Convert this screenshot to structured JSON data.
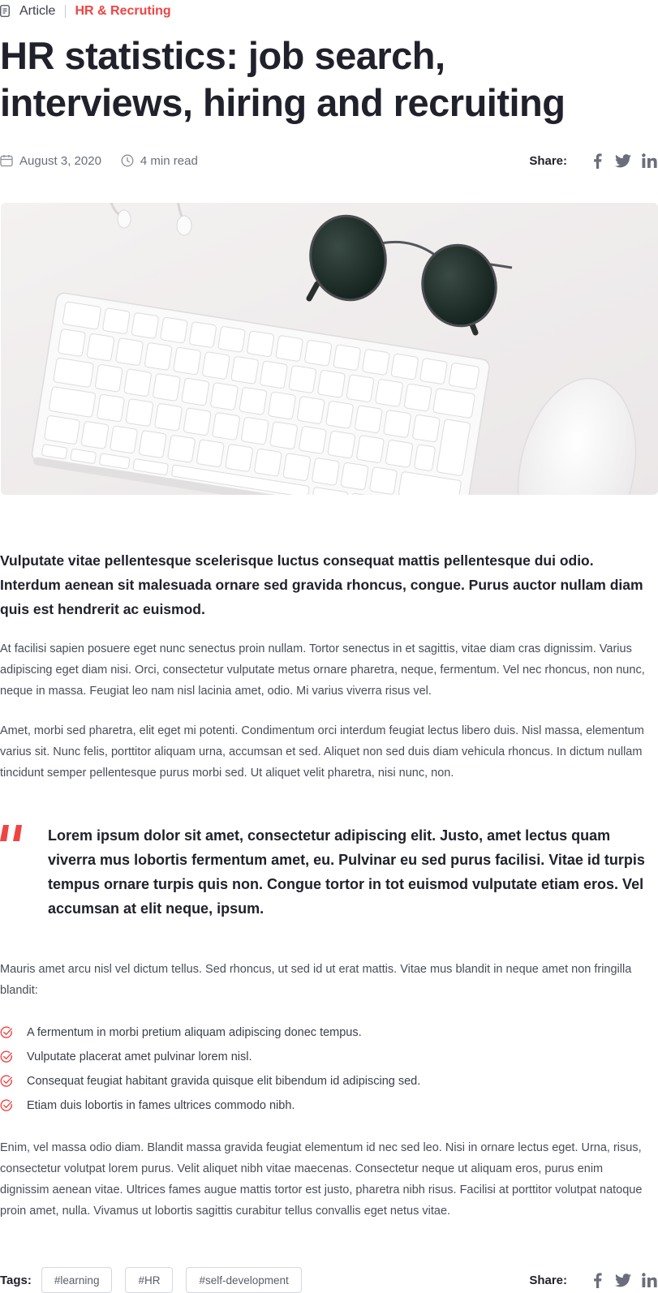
{
  "breadcrumb": {
    "type_label": "Article",
    "category_label": "HR & Recruting"
  },
  "article": {
    "title": "HR statistics: job search,  interviews, hiring and recruiting",
    "date": "August 3, 2020",
    "read_time": "4 min read",
    "share_label": "Share:",
    "hero_image": "keyboard-sunglasses-mouse-photo",
    "lead": "Vulputate vitae pellentesque scelerisque luctus consequat mattis pellentesque dui odio. Interdum aenean sit malesuada ornare sed gravida rhoncus, congue. Purus auctor nullam diam quis est hendrerit ac euismod.",
    "paragraph_1": "At facilisi sapien posuere eget nunc senectus proin nullam. Tortor senectus in et sagittis, vitae diam cras dignissim. Varius adipiscing eget diam nisi. Orci, consectetur vulputate metus ornare pharetra, neque, fermentum. Vel nec rhoncus, non nunc, neque in massa. Feugiat leo nam nisl lacinia amet, odio. Mi varius viverra risus vel.",
    "paragraph_2": "Amet, morbi sed pharetra, elit eget mi potenti. Condimentum orci interdum feugiat lectus libero duis. Nisl massa, elementum varius sit. Nunc felis, porttitor aliquam urna, accumsan et sed. Aliquet non sed duis diam vehicula rhoncus. In dictum nullam tincidunt semper pellentesque purus morbi sed. Ut aliquet velit pharetra, nisi nunc, non.",
    "quote": "Lorem ipsum dolor sit amet, consectetur adipiscing elit. Justo, amet lectus quam viverra mus lobortis fermentum amet, eu. Pulvinar eu sed purus  facilisi. Vitae id turpis tempus ornare turpis quis non. Congue tortor in tot euismod vulputate etiam eros. Vel accumsan at elit neque, ipsum.",
    "paragraph_3": "Mauris amet arcu nisl vel dictum tellus. Sed rhoncus, ut sed id ut erat mattis. Vitae mus blandit in neque amet non fringilla blandit:",
    "checklist": [
      "A fermentum in morbi pretium aliquam adipiscing donec tempus.",
      "Vulputate placerat amet pulvinar lorem nisl.",
      "Consequat feugiat habitant gravida quisque elit bibendum id adipiscing sed.",
      "Etiam duis lobortis in fames ultrices commodo nibh."
    ],
    "paragraph_4": "Enim, vel massa odio diam. Blandit massa gravida feugiat elementum id nec sed leo. Nisi in ornare lectus eget. Urna, risus, consectetur volutpat lorem purus. Velit aliquet nibh vitae maecenas. Consectetur neque ut aliquam eros, purus enim dignissim aenean vitae. Ultrices fames augue mattis tortor est justo, pharetra nibh risus. Facilisi at porttitor volutpat natoque proin amet, nulla. Vivamus ut lobortis sagittis curabitur tellus convallis eget netus vitae."
  },
  "footer": {
    "tags_label": "Tags:",
    "tags": [
      "#learning",
      "#HR",
      "#self-development"
    ],
    "share_label": "Share:"
  },
  "icons": {
    "document": "document-icon",
    "calendar": "calendar-icon",
    "clock": "clock-icon",
    "facebook": "facebook-icon",
    "twitter": "twitter-icon",
    "linkedin": "linkedin-icon",
    "quote": "quote-icon",
    "check": "check-circle-icon"
  },
  "colors": {
    "accent": "#ef4444",
    "heading": "#20212b",
    "body": "#4a4d58",
    "muted": "#6b6e7a"
  }
}
